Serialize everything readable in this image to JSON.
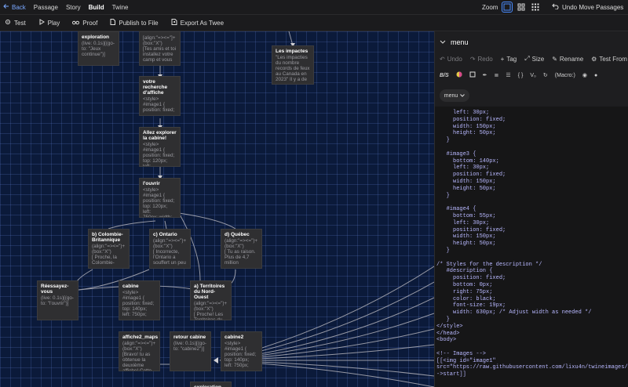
{
  "topbar": {
    "back": "Back",
    "menu": [
      "Passage",
      "Story",
      "Build",
      "Twine"
    ],
    "zoom_label": "Zoom",
    "undo_move": "Undo Move Passages"
  },
  "toolbar": {
    "test": "Test",
    "play": "Play",
    "proof": "Proof",
    "publish": "Publish to File",
    "export": "Export As Twee"
  },
  "canvas": {
    "passages": [
      {
        "title": "exploration",
        "body": "(live: 0.1s)[(go-to: \"Jeux continue\")]"
      },
      {
        "title": "",
        "body": "[align:\"=><=\"]+(box:\"X\")\n[Tes amis et toi installez votre camp et vous"
      },
      {
        "title": "Les impactes",
        "body": "\"Les impacties du nombre records de feux au Canada en 2023\" Il y a de"
      },
      {
        "title": "votre recherche d'affiche",
        "body": "<style>\n#image1 {\nposition: fixed;"
      },
      {
        "title": "Allez explorer la cabine!",
        "body": "<style>\n#image1 {\nposition: fixed;\ntop: 120px; left:"
      },
      {
        "title": "l'ouvrir",
        "body": "<style>\n#image1 {\nposition: fixed;\ntop: 120px; left:\n750px; width:"
      },
      {
        "title": "b) Colombie-Britannique",
        "body": "(align:\"=><=\")+(box:\"X\")\n[ Proche, la Colombie-"
      },
      {
        "title": "c) Ontario",
        "body": "(align:\"=><=\")+(box:\"X\")\n[ Incorrecte, l'Ontario a souffert un peu"
      },
      {
        "title": "d) Québec",
        "body": "(align:\"=><=\")+(box:\"X\")\n[ Tu as raison. Plus de 4,7 million"
      },
      {
        "title": "Réessayez-vous",
        "body": "(live: 0.1s)[(go-to: \"l'ouvrir\")]"
      },
      {
        "title": "cabine",
        "body": "<style>\n#image1 {\nposition: fixed;\ntop: 140px;\nleft: 750px;"
      },
      {
        "title": "a) Territoires du Nord-Ouest",
        "body": "(align:\"=><=\")+(box:\"X\")\n[ Proche! Les Territoires du Nord-Ouest"
      },
      {
        "title": "affiche2_maps",
        "body": "(align:\"=><=\")+(box:\"X\")\n[Bravo! tu as obtenue la deuxième affiche! Cette"
      },
      {
        "title": "retour cabine",
        "body": "(live: 0.1s)[(go-to: \"cabine2\")]"
      },
      {
        "title": "cabine2",
        "body": "<style>\n#image1 {\nposition: fixed;\ntop: 140px;\nleft: 750px;"
      },
      {
        "title": "exploration",
        "body": ""
      }
    ]
  },
  "panel": {
    "title": "menu",
    "actions": [
      "Undo",
      "Redo",
      "Tag",
      "Size",
      "Rename",
      "Test From"
    ],
    "format_macro": "(Macro:)",
    "mode": "menu",
    "code_lines": [
      "     left: 30px;",
      "     position: fixed;",
      "     width: 150px;",
      "     height: 50px;",
      "   }",
      "",
      "   #image3 {",
      "     bottom: 140px;",
      "     left: 30px;",
      "     position: fixed;",
      "     width: 150px;",
      "     height: 50px;",
      "   }",
      "",
      "   #image4 {",
      "     bottom: 55px;",
      "     left: 30px;",
      "     position: fixed;",
      "     width: 150px;",
      "     height: 50px;",
      "   }",
      "",
      "/* Styles for the description */",
      "   #description {",
      "     position: fixed;",
      "     bottom: 0px;",
      "     right: 75px;",
      "     color: black;",
      "     font-size: 19px;",
      "     width: 630px; /* Adjust width as needed */",
      "   }",
      "</style>",
      "</head>",
      "<body>",
      "",
      "<!-- Images -->",
      "[[<img id=\"image1\"",
      "src=\"https://raw.githubusercontent.com/lixu4n/twineimages/main/comm",
      "->start]]"
    ]
  },
  "colors": {
    "accent": "#4a8cff",
    "canvas_bg": "#0b1a3a",
    "card_bg": "#2f2f31"
  }
}
